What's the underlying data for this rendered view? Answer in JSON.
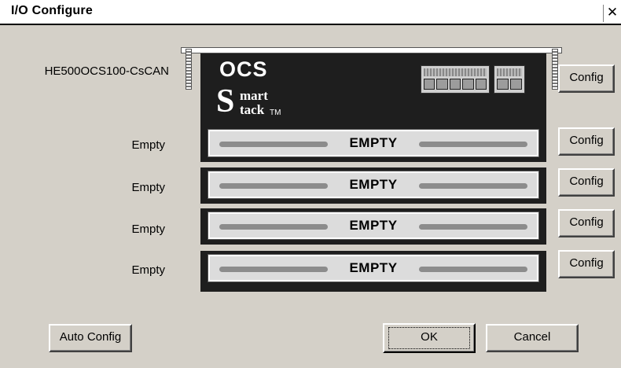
{
  "window": {
    "title": "I/O Configure",
    "close_glyph": "✕"
  },
  "base_module": {
    "name": "HE500OCS100-CsCAN",
    "brand": "OCS",
    "logo_s": "S",
    "logo_mart": "mart",
    "logo_tack": "tack",
    "logo_tm": "TM",
    "config_label": "Config"
  },
  "slots": [
    {
      "label": "Empty",
      "slot_text": "EMPTY",
      "config_label": "Config"
    },
    {
      "label": "Empty",
      "slot_text": "EMPTY",
      "config_label": "Config"
    },
    {
      "label": "Empty",
      "slot_text": "EMPTY",
      "config_label": "Config"
    },
    {
      "label": "Empty",
      "slot_text": "EMPTY",
      "config_label": "Config"
    }
  ],
  "footer": {
    "auto_config_label": "Auto Config",
    "ok_label": "OK",
    "cancel_label": "Cancel"
  }
}
